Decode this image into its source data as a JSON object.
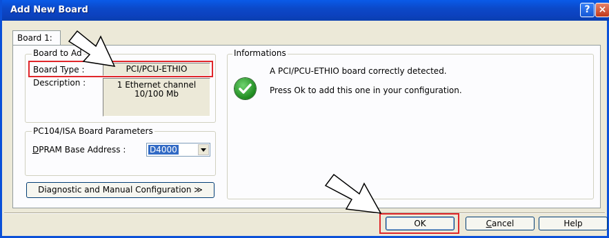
{
  "window": {
    "title": "Add New Board",
    "help_glyph": "?",
    "close_glyph": "×"
  },
  "tab": {
    "label": "Board 1:"
  },
  "board_to_add": {
    "legend": "Board to Ad",
    "type_label": "Board Type :",
    "type_value": "PCI/PCU-ETHIO",
    "description_label": "Description :",
    "description_line1": "1 Ethernet channel",
    "description_line2": "10/100 Mb"
  },
  "pc104": {
    "legend": "PC104/ISA Board Parameters",
    "dpram_label_first": "D",
    "dpram_label_rest": "PRAM Base Address :",
    "dpram_value": "D4000"
  },
  "diag_button": {
    "label": "Diagnostic and Manual Configuration ≫"
  },
  "informations": {
    "legend": "Informations",
    "line1": "A PCI/PCU-ETHIO board correctly detected.",
    "line2": "Press Ok to add this one in your configuration.",
    "icon": "check-icon"
  },
  "buttons": {
    "ok": "OK",
    "cancel_first": "C",
    "cancel_rest": "ancel",
    "help": "Help"
  },
  "colors": {
    "highlight": "#e0262a",
    "titlebar": "#0b49c9",
    "selection": "#316ac5"
  }
}
